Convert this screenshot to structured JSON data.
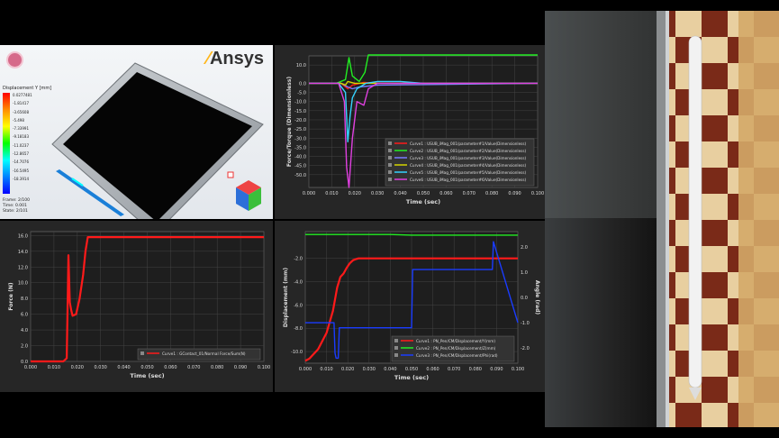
{
  "simulation": {
    "brand": "Ansys",
    "legend_title": "Displacement Y [mm]",
    "legend_values": [
      "0.0277481",
      "-1.81417",
      "-3.65608",
      "-5.498",
      "-7.33991",
      "-9.18183",
      "-11.0237",
      "-12.8657",
      "-14.7076",
      "-16.5495",
      "-18.3914"
    ],
    "frame": "Frame: 2/100",
    "time": "Time: 0.001",
    "state": "State: 2/101"
  },
  "colors": {
    "panel_bg": "#262626",
    "grid": "#555555",
    "red": "#ff1a1a",
    "green": "#22ee22",
    "blue": "#1a3cff"
  },
  "chart_data": [
    {
      "id": "force_torque",
      "type": "line",
      "title": "",
      "xlabel": "Time (sec)",
      "ylabel": "Force/Torque (Dimensionless)",
      "xlim": [
        0,
        0.1
      ],
      "ylim": [
        -57,
        15
      ],
      "x_ticks": [
        "0.000",
        "0.010",
        "0.020",
        "0.030",
        "0.040",
        "0.050",
        "0.060",
        "0.070",
        "0.080",
        "0.090",
        "0.100"
      ],
      "y_ticks": [
        10.0,
        0.0,
        -5.0,
        -10.0,
        -15.0,
        -20.0,
        -25.0,
        -30.0,
        -35.0,
        -40.0,
        -45.0,
        -50.0
      ],
      "y_tick_labels": [
        "10.0",
        "0.0",
        "-5.0",
        "-10.0",
        "-15.0",
        "-20.0",
        "-25.0",
        "-30.0",
        "-35.0",
        "-40.0",
        "-45.0",
        "-50.0"
      ],
      "legend_position": "bottom-right",
      "series": [
        {
          "name": "Curve1 : USUB_iMag_001/parameter#1/Value(Dimensionless)",
          "color": "#ff1a1a",
          "x": [
            0,
            0.014,
            0.017,
            0.019,
            0.024,
            0.03,
            0.1
          ],
          "y": [
            0,
            0,
            -3,
            -1,
            0.5,
            0,
            0
          ]
        },
        {
          "name": "Curve2 : USUB_iMag_001/parameter#2/Value(Dimensionless)",
          "color": "#22ee22",
          "x": [
            0,
            0.012,
            0.016,
            0.0175,
            0.019,
            0.022,
            0.0245,
            0.026,
            0.03,
            0.1
          ],
          "y": [
            0,
            0,
            2,
            14,
            4,
            1,
            6,
            15.5,
            15.5,
            15.5
          ]
        },
        {
          "name": "Curve3 : USUB_iMag_001/parameter#3/Value(Dimensionless)",
          "color": "#7a7aff",
          "x": [
            0,
            0.014,
            0.017,
            0.019,
            0.022,
            0.03,
            0.1
          ],
          "y": [
            0,
            0,
            -2,
            -3,
            -2,
            -1,
            0
          ]
        },
        {
          "name": "Curve4 : USUB_iMag_001/parameter#4/Value(Dimensionless)",
          "color": "#d4d400",
          "x": [
            0,
            0.014,
            0.016,
            0.017,
            0.02,
            0.03,
            0.1
          ],
          "y": [
            0,
            0,
            -1,
            1,
            0,
            0,
            0
          ]
        },
        {
          "name": "Curve5 : USUB_iMag_001/parameter#5/Value(Dimensionless)",
          "color": "#35d3ff",
          "x": [
            0,
            0.013,
            0.016,
            0.017,
            0.018,
            0.019,
            0.021,
            0.025,
            0.03,
            0.04,
            0.05,
            0.06,
            0.1
          ],
          "y": [
            0,
            0,
            -5,
            -32,
            -18,
            -8,
            -3,
            0,
            1,
            1,
            0,
            0,
            0
          ]
        },
        {
          "name": "Curve6 : USUB_iMag_001/parameter#6/Value(Dimensionless)",
          "color": "#e040e0",
          "x": [
            0,
            0.013,
            0.0155,
            0.0165,
            0.0175,
            0.019,
            0.021,
            0.024,
            0.026,
            0.03,
            0.1
          ],
          "y": [
            0,
            0,
            -10,
            -46,
            -57,
            -30,
            -10,
            -12,
            -3,
            0,
            0
          ]
        }
      ]
    },
    {
      "id": "normal_force",
      "type": "line",
      "title": "",
      "xlabel": "Time (sec)",
      "ylabel": "Force (N)",
      "xlim": [
        0,
        0.1
      ],
      "ylim": [
        0,
        16.5
      ],
      "x_ticks": [
        "0.000",
        "0.010",
        "0.020",
        "0.030",
        "0.040",
        "0.050",
        "0.060",
        "0.070",
        "0.080",
        "0.090",
        "0.100"
      ],
      "y_ticks": [
        0,
        2,
        4,
        6,
        8,
        10,
        12,
        14,
        16
      ],
      "y_tick_labels": [
        "0.0",
        "2.0",
        "4.0",
        "6.0",
        "8.0",
        "10.0",
        "12.0",
        "14.0",
        "16.0"
      ],
      "legend_position": "bottom-right",
      "series": [
        {
          "name": "Curve1 : GContact_01/Normal Force/Sum(N)",
          "color": "#ff1a1a",
          "x": [
            0,
            0.014,
            0.0155,
            0.0162,
            0.0168,
            0.0174,
            0.018,
            0.0195,
            0.021,
            0.0225,
            0.0235,
            0.0245,
            0.025,
            0.03,
            0.1
          ],
          "y": [
            0,
            0,
            0.4,
            13.5,
            7.5,
            6.5,
            5.8,
            6,
            8,
            11,
            14,
            15.8,
            15.8,
            15.8,
            15.8
          ]
        }
      ]
    },
    {
      "id": "displacement_angle",
      "type": "line",
      "title": "",
      "xlabel": "Time (sec)",
      "ylabel": "Displacement (mm)",
      "ylabel_right": "Angle (rad)",
      "xlim": [
        0,
        0.1
      ],
      "ylim": [
        -11,
        0.3
      ],
      "ylim_right": [
        -2.6,
        2.6
      ],
      "x_ticks": [
        "0.000",
        "0.010",
        "0.020",
        "0.030",
        "0.040",
        "0.050",
        "0.060",
        "0.070",
        "0.080",
        "0.090",
        "0.100"
      ],
      "y_ticks": [
        -2,
        -4,
        -6,
        -8,
        -10
      ],
      "y_tick_labels": [
        "-2.0",
        "-4.0",
        "-6.0",
        "-8.0",
        "-10.0"
      ],
      "y_right_ticks": [
        2,
        1,
        0,
        -1,
        -2
      ],
      "y_right_tick_labels": [
        "2.0",
        "1.0",
        "0.0",
        "-1.0",
        "-2.0"
      ],
      "legend_position": "bottom-right",
      "series": [
        {
          "name": "Curve1 : PN_Pen/CM/Displacement/Y(mm)",
          "color": "#ff1a1a",
          "axis": "left",
          "x": [
            0,
            0.002,
            0.006,
            0.01,
            0.013,
            0.015,
            0.0165,
            0.018,
            0.0195,
            0.021,
            0.0225,
            0.024,
            0.025,
            0.1
          ],
          "y": [
            -10.8,
            -10.6,
            -9.8,
            -8.4,
            -6.5,
            -4.5,
            -3.6,
            -3.3,
            -2.8,
            -2.4,
            -2.15,
            -2.05,
            -2,
            -2
          ]
        },
        {
          "name": "Curve2 : PN_Pen/CM/Displacement/Z(mm)",
          "color": "#22ee22",
          "axis": "left",
          "x": [
            0,
            0.04,
            0.05,
            0.1
          ],
          "y": [
            0.05,
            0.05,
            0.0,
            0.0
          ]
        },
        {
          "name": "Curve3 : PN_Pen/CM/Displacement/Phi(rad)",
          "color": "#1a3cff",
          "axis": "right",
          "x": [
            0,
            0.009,
            0.01,
            0.0135,
            0.014,
            0.0145,
            0.0155,
            0.016,
            0.0165,
            0.05,
            0.0505,
            0.068,
            0.088,
            0.0885,
            0.1
          ],
          "y": [
            -1.0,
            -1.0,
            -1.0,
            -1.0,
            -2.2,
            -2.4,
            -2.4,
            -1.2,
            -1.2,
            -1.2,
            1.1,
            1.1,
            1.1,
            2.2,
            -1.0
          ]
        }
      ]
    }
  ]
}
